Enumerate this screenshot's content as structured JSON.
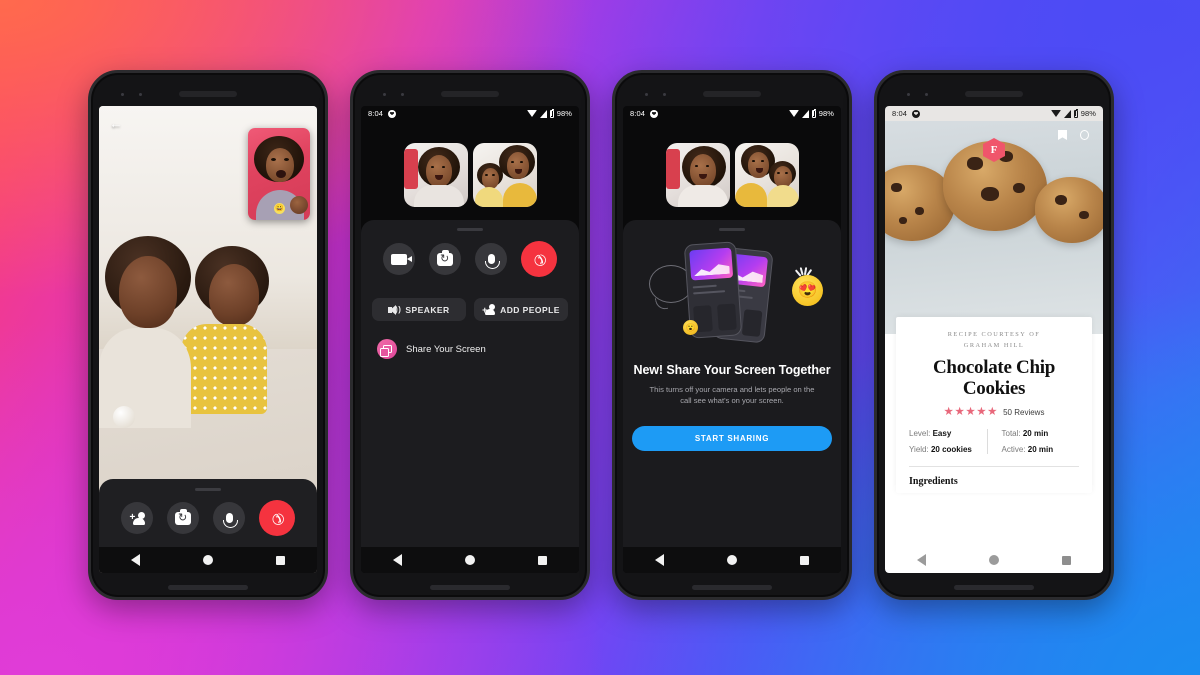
{
  "background": {
    "gradient_colors": [
      "#FF6A4D",
      "#FF3D6E",
      "#D633D6",
      "#8A3FF0",
      "#5B4BF7",
      "#1A8CF0"
    ]
  },
  "phones": {
    "phone1": {
      "name": "video-call-fullscreen",
      "back_icon": "←",
      "controls": [
        {
          "name": "add-person",
          "icon": "add-person-icon"
        },
        {
          "name": "flip-camera",
          "icon": "camera-flip-icon"
        },
        {
          "name": "mute-mic",
          "icon": "microphone-icon"
        },
        {
          "name": "end-call",
          "icon": "end-call-icon"
        }
      ],
      "pip_emoji": "😀"
    },
    "phone2": {
      "name": "call-controls",
      "statusbar": {
        "time": "8:04",
        "battery": "98%",
        "app_icon": "messenger-icon"
      },
      "controls": [
        {
          "name": "video",
          "icon": "video-camera-icon"
        },
        {
          "name": "flip-camera",
          "icon": "camera-flip-icon"
        },
        {
          "name": "mute-mic",
          "icon": "microphone-icon"
        },
        {
          "name": "end-call",
          "icon": "end-call-icon"
        }
      ],
      "speaker_label": "SPEAKER",
      "add_people_label": "ADD PEOPLE",
      "share_screen_label": "Share Your Screen"
    },
    "phone3": {
      "name": "share-screen-promo",
      "statusbar": {
        "time": "8:04",
        "battery": "98%",
        "app_icon": "messenger-icon"
      },
      "title": "New! Share Your Screen Together",
      "subtitle": "This turns off your camera and lets people on the call see what's on your screen.",
      "cta_label": "START SHARING",
      "emoji_large": "😍",
      "emoji_small": "😮"
    },
    "phone4": {
      "name": "recipe-screen-share",
      "statusbar": {
        "time": "8:04",
        "battery": "98%",
        "app_icon": "messenger-icon"
      },
      "badge_letter": "F",
      "courtesy_line1": "RECIPE COURTESY OF",
      "courtesy_line2": "GRAHAM HILL",
      "title_line1": "Chocolate Chip",
      "title_line2": "Cookies",
      "stars": "★★★★★",
      "reviews": "50 Reviews",
      "meta": [
        {
          "label": "Level:",
          "value": "Easy"
        },
        {
          "label": "Total:",
          "value": "20 min"
        },
        {
          "label": "Yield:",
          "value": "20 cookies"
        },
        {
          "label": "Active:",
          "value": "20 min"
        }
      ],
      "ingredients_heading": "Ingredients"
    }
  },
  "navbar": {
    "back": "nav-back-icon",
    "home": "nav-home-icon",
    "recents": "nav-recents-icon"
  }
}
